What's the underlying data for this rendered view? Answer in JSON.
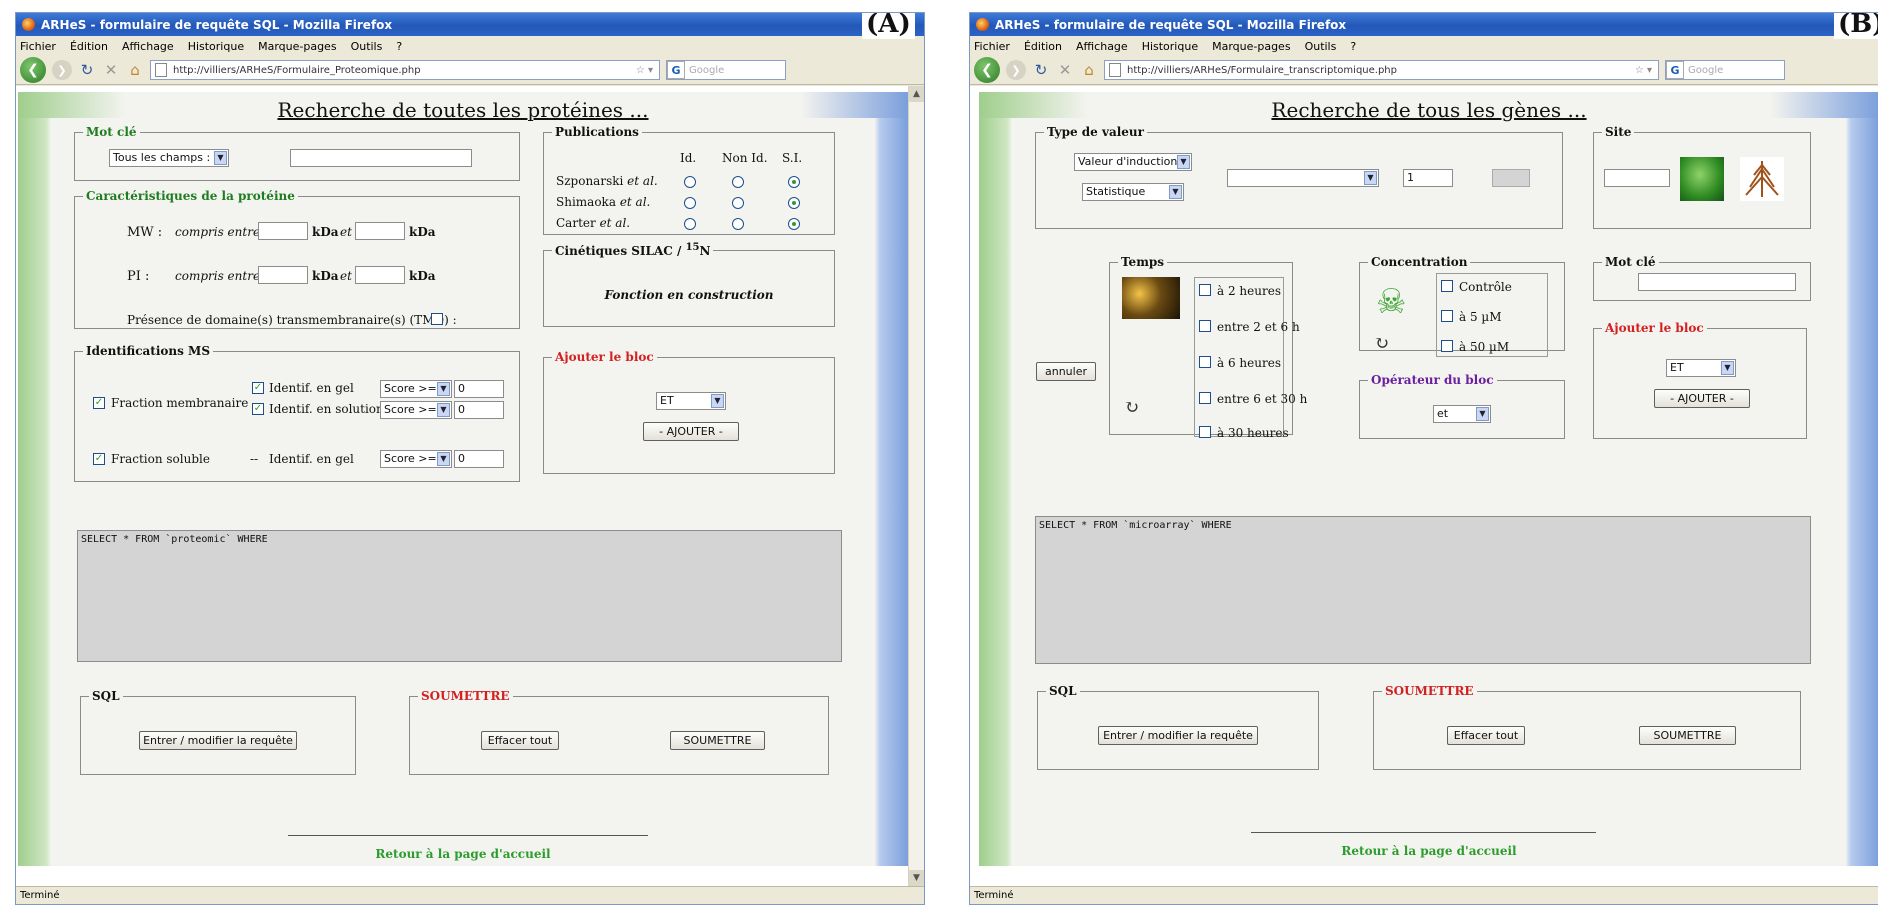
{
  "panel_a": {
    "label": "(A)",
    "window_title": "ARHeS - formulaire de requête SQL - Mozilla Firefox",
    "menu": [
      "Fichier",
      "Édition",
      "Affichage",
      "Historique",
      "Marque-pages",
      "Outils",
      "?"
    ],
    "url": "http://villiers/ARHeS/Formulaire_Proteomique.php",
    "search_placeholder": "Google",
    "status": "Terminé",
    "page_title": "Recherche de toutes les protéines ...",
    "mot_cle": {
      "legend": "Mot clé",
      "select": "Tous les champs :",
      "value": ""
    },
    "caracteristiques": {
      "legend": "Caractéristiques de la protéine",
      "mw_label": "MW :",
      "pi_label": "PI :",
      "compris": "compris entre",
      "kda": "kDa",
      "et": "et",
      "tmd_label": "Présence de domaine(s) transmembranaire(s) (TMD) :"
    },
    "publications": {
      "legend": "Publications",
      "cols": [
        "Id.",
        "Non Id.",
        "S.I."
      ],
      "rows": [
        {
          "name": "Szponarski",
          "etal": "et al.",
          "selected": 2
        },
        {
          "name": "Shimaoka",
          "etal": "et al.",
          "selected": 2
        },
        {
          "name": "Carter",
          "etal": "et al.",
          "selected": 2
        }
      ]
    },
    "cinetiques": {
      "legend_main": "Cinétiques SILAC / ",
      "legend_sup": "15",
      "legend_end": "N",
      "text": "Fonction en construction"
    },
    "identifications": {
      "legend": "Identifications MS",
      "fraction_membranaire": "Fraction membranaire",
      "identif_gel": "Identif. en gel",
      "identif_solution": "Identif. en solution",
      "fraction_soluble": "Fraction soluble",
      "dashes": "--",
      "score": "Score >=",
      "zero": "0"
    },
    "ajouter": {
      "legend": "Ajouter le bloc",
      "select": "ET",
      "button": "- AJOUTER -"
    },
    "sql_text": "SELECT * FROM `proteomic` WHERE",
    "sql": {
      "legend": "SQL",
      "button": "Entrer / modifier la requête"
    },
    "soumettre": {
      "legend": "SOUMETTRE",
      "effacer": "Effacer tout",
      "submit": "SOUMETTRE"
    },
    "retour": "Retour à la page d'accueil"
  },
  "panel_b": {
    "label": "(B)",
    "window_title": "ARHeS - formulaire de requête SQL - Mozilla Firefox",
    "menu": [
      "Fichier",
      "Édition",
      "Affichage",
      "Historique",
      "Marque-pages",
      "Outils",
      "?"
    ],
    "url": "http://villiers/ARHeS/Formulaire_transcriptomique.php",
    "search_placeholder": "Google",
    "status": "Terminé",
    "page_title": "Recherche de tous les gènes ...",
    "type_valeur": {
      "legend": "Type de valeur",
      "select1": "Valeur d'induction",
      "select2": "Statistique",
      "select3": "",
      "value": "1"
    },
    "site": {
      "legend": "Site"
    },
    "temps": {
      "legend": "Temps",
      "options": [
        "à 2 heures",
        "entre 2 et 6 h",
        "à 6 heures",
        "entre 6 et 30 h",
        "à 30 heures"
      ]
    },
    "concentration": {
      "legend": "Concentration",
      "options": [
        "Contrôle",
        "à 5 µM",
        "à 50 µM"
      ]
    },
    "operateur": {
      "legend": "Opérateur du bloc",
      "select": "et"
    },
    "mot_cle": {
      "legend": "Mot clé"
    },
    "ajouter": {
      "legend": "Ajouter le bloc",
      "select": "ET",
      "button": "- AJOUTER -"
    },
    "annuler": "annuler",
    "sql_text": "SELECT * FROM `microarray` WHERE",
    "sql": {
      "legend": "SQL",
      "button": "Entrer / modifier la requête"
    },
    "soumettre": {
      "legend": "SOUMETTRE",
      "effacer": "Effacer tout",
      "submit": "SOUMETTRE"
    },
    "retour": "Retour à la page d'accueil"
  }
}
